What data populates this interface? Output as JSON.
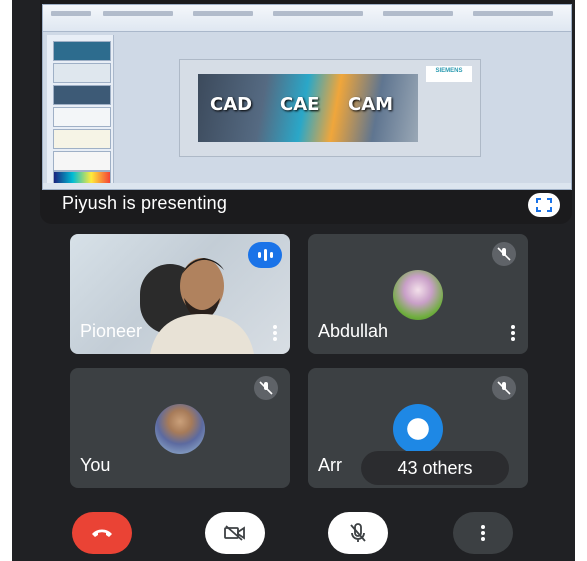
{
  "presentation": {
    "presenter_label": "Piyush is presenting",
    "slide": {
      "words": [
        "CAD",
        "CAE",
        "CAM"
      ],
      "logo_text": "SIEMENS"
    }
  },
  "participants": [
    {
      "name": "Pioneer",
      "speaking": true
    },
    {
      "name": "Abdullah",
      "muted": true
    },
    {
      "name": "You",
      "muted": true
    },
    {
      "name": "Arr",
      "muted": true
    }
  ],
  "others_badge": "43 others",
  "controls": {
    "end_call_color": "#ea4335",
    "button_color": "#ffffff",
    "more_color": "#3c4043"
  }
}
